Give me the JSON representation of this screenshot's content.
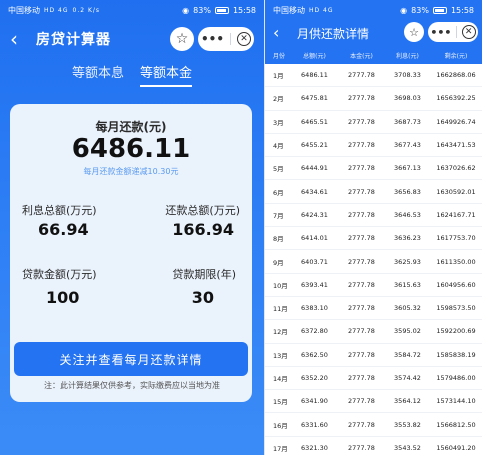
{
  "left": {
    "status": {
      "carrier": "中国移动",
      "signal": "HD 4G",
      "speed": "0.2 K/s",
      "battery": "83%",
      "time": "15:58"
    },
    "header": {
      "title": "房贷计算器"
    },
    "tabs": [
      "等额本息",
      "等额本金"
    ],
    "card": {
      "monthly_label": "每月还款(元)",
      "monthly_value": "6486.11",
      "monthly_note": "每月还款金额递减10.30元",
      "interest_label": "利息总额(万元)",
      "interest_value": "66.94",
      "repay_label": "还款总额(万元)",
      "repay_value": "166.94",
      "loan_label": "贷款金额(万元)",
      "loan_value": "100",
      "term_label": "贷款期限(年)",
      "term_value": "30"
    },
    "cta": "关注并查看每月还款详情",
    "disclaimer": "注：此计算结果仅供参考，实际缴费应以当地为准"
  },
  "right": {
    "status": {
      "carrier": "中国移动",
      "signal": "HD 4G",
      "battery": "83%",
      "time": "15:58"
    },
    "header": {
      "title": "月供还款详情"
    },
    "columns": [
      "月份",
      "总额(元)",
      "本金(元)",
      "利息(元)",
      "剩余(元)"
    ],
    "rows": [
      [
        "1月",
        "6486.11",
        "2777.78",
        "3708.33",
        "1662868.06"
      ],
      [
        "2月",
        "6475.81",
        "2777.78",
        "3698.03",
        "1656392.25"
      ],
      [
        "3月",
        "6465.51",
        "2777.78",
        "3687.73",
        "1649926.74"
      ],
      [
        "4月",
        "6455.21",
        "2777.78",
        "3677.43",
        "1643471.53"
      ],
      [
        "5月",
        "6444.91",
        "2777.78",
        "3667.13",
        "1637026.62"
      ],
      [
        "6月",
        "6434.61",
        "2777.78",
        "3656.83",
        "1630592.01"
      ],
      [
        "7月",
        "6424.31",
        "2777.78",
        "3646.53",
        "1624167.71"
      ],
      [
        "8月",
        "6414.01",
        "2777.78",
        "3636.23",
        "1617753.70"
      ],
      [
        "9月",
        "6403.71",
        "2777.78",
        "3625.93",
        "1611350.00"
      ],
      [
        "10月",
        "6393.41",
        "2777.78",
        "3615.63",
        "1604956.60"
      ],
      [
        "11月",
        "6383.10",
        "2777.78",
        "3605.32",
        "1598573.50"
      ],
      [
        "12月",
        "6372.80",
        "2777.78",
        "3595.02",
        "1592200.69"
      ],
      [
        "13月",
        "6362.50",
        "2777.78",
        "3584.72",
        "1585838.19"
      ],
      [
        "14月",
        "6352.20",
        "2777.78",
        "3574.42",
        "1579486.00"
      ],
      [
        "15月",
        "6341.90",
        "2777.78",
        "3564.12",
        "1573144.10"
      ],
      [
        "16月",
        "6331.60",
        "2777.78",
        "3553.82",
        "1566812.50"
      ],
      [
        "17月",
        "6321.30",
        "2777.78",
        "3543.52",
        "1560491.20"
      ]
    ]
  }
}
